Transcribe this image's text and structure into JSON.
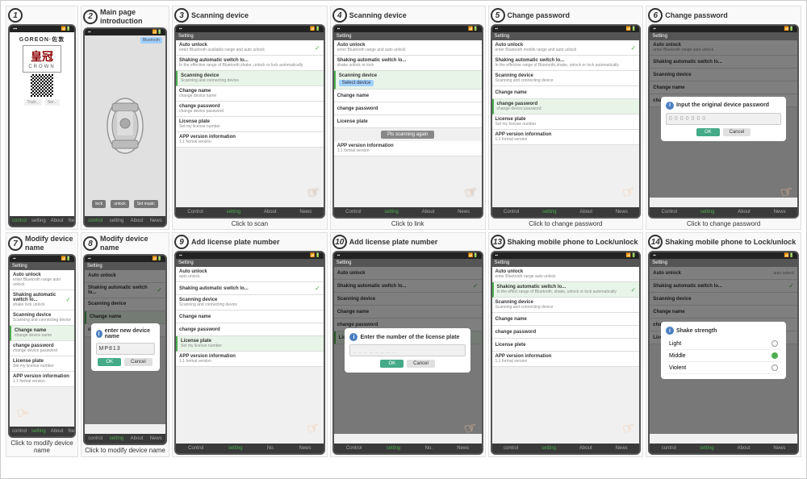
{
  "steps": [
    {
      "number": "1",
      "title": "",
      "type": "logo",
      "caption": ""
    },
    {
      "number": "2",
      "title": "Main page introduction",
      "type": "car",
      "caption": ""
    },
    {
      "number": "3",
      "title": "Scanning device",
      "type": "settings",
      "caption": "Click to scan",
      "highlighted": "Scanning device"
    },
    {
      "number": "4",
      "title": "Scanning device",
      "type": "settings_scan",
      "caption": "Click to link"
    },
    {
      "number": "5",
      "title": "Change password",
      "type": "settings",
      "caption": "Click to change password",
      "highlighted": "change password"
    },
    {
      "number": "6",
      "title": "Change password",
      "type": "settings_dialog_pwd",
      "caption": "Click to change password"
    },
    {
      "number": "7",
      "title": "Modify device name",
      "type": "settings",
      "caption": "Click to modify device name",
      "highlighted": "Change name"
    },
    {
      "number": "8",
      "title": "Modify device name",
      "type": "settings_dialog_name",
      "caption": "Click to modify device name"
    },
    {
      "number": "9",
      "title": "Add license plate number",
      "type": "settings",
      "caption": "",
      "highlighted": "License plate"
    },
    {
      "number": "10",
      "title": "Add license plate number",
      "type": "settings_dialog_plate",
      "caption": ""
    },
    {
      "number": "13",
      "title": "Shaking mobile phone to Lock/unlock",
      "type": "settings",
      "caption": "",
      "highlighted": "Shaking automatic switch lo..."
    },
    {
      "number": "14",
      "title": "Shaking mobile phone to Lock/unlock",
      "type": "settings_shake",
      "caption": ""
    }
  ],
  "app": {
    "brand": "GOREON·佐敦",
    "logo_text": "皇冠",
    "logo_eng": "CROWN",
    "settings_items": [
      {
        "title": "Auto unlock",
        "desc": "enter Bluetooth available range and auto unlock"
      },
      {
        "title": "Shaking automatic switch lo...",
        "desc": "In the effective range of Bluetooth, shake, unlock or lock automatically"
      },
      {
        "title": "Scanning device",
        "desc": "Scanning and connecting device"
      },
      {
        "title": "Change name",
        "desc": "change device name"
      },
      {
        "title": "change password",
        "desc": "change device password"
      },
      {
        "title": "License plate",
        "desc": "Set my license number"
      },
      {
        "title": "APP version information",
        "desc": "1.1 formal version"
      }
    ],
    "nav_items": [
      "Control",
      "Setting",
      "About",
      "News"
    ],
    "dialogs": {
      "pwd": {
        "title": "Input the original device password",
        "placeholder": "0000000",
        "ok": "OK",
        "cancel": "Cancel"
      },
      "name": {
        "title": "enter new device name",
        "value": "MP813",
        "ok": "OK",
        "cancel": "Cancel"
      },
      "plate": {
        "title": "Enter the number of the license plate",
        "value": "",
        "ok": "OK",
        "cancel": "Cancel"
      },
      "scan_again": "Pls scanning again"
    },
    "shake_options": [
      "Light",
      "Middle",
      "Violent"
    ]
  },
  "row2_captions": {
    "step7": "Click to modify device name",
    "step8": "Click to modify device name"
  }
}
